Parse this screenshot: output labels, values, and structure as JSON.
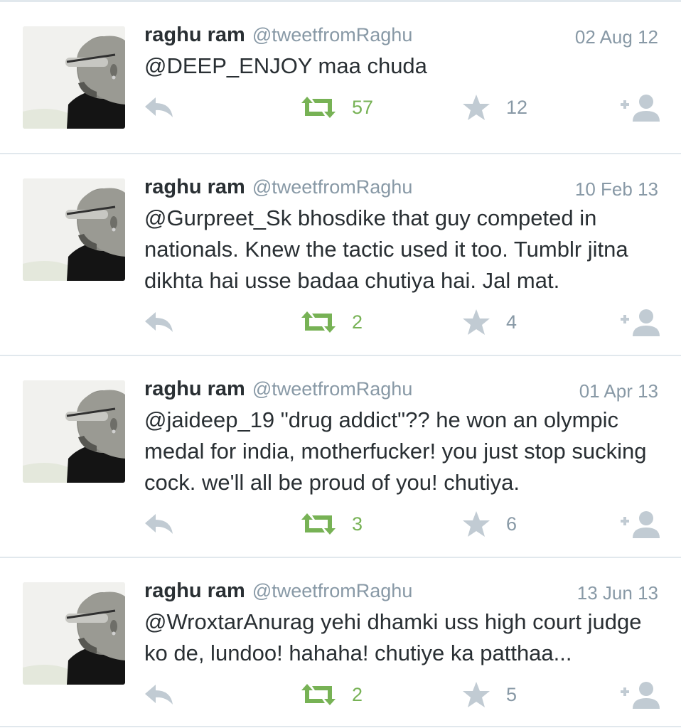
{
  "colors": {
    "retweet_active": "#77b255",
    "icon_gray": "#c1cbd3",
    "meta_gray": "#8899a6",
    "text": "#292f33",
    "divider": "#e1e8ed"
  },
  "icons": {
    "reply": "reply-arrow-icon",
    "retweet": "retweet-icon",
    "favorite": "star-icon",
    "follow": "add-user-icon"
  },
  "tweets": [
    {
      "name": "raghu ram",
      "handle": "@tweetfromRaghu",
      "date": "02 Aug 12",
      "text": "@DEEP_ENJOY maa chuda",
      "retweets": "57",
      "favorites": "12"
    },
    {
      "name": "raghu ram",
      "handle": "@tweetfromRaghu",
      "date": "10 Feb 13",
      "text": "@Gurpreet_Sk bhosdike that guy competed in nationals. Knew the tactic used it too. Tumblr jitna dikhta hai usse badaa chutiya hai. Jal mat.",
      "retweets": "2",
      "favorites": "4"
    },
    {
      "name": "raghu ram",
      "handle": "@tweetfromRaghu",
      "date": "01 Apr 13",
      "text": "@jaideep_19 \"drug addict\"?? he won an olympic medal for india, motherfucker! you just stop sucking cock. we'll all be proud of you! chutiya.",
      "retweets": "3",
      "favorites": "6"
    },
    {
      "name": "raghu ram",
      "handle": "@tweetfromRaghu",
      "date": "13 Jun 13",
      "text": "@WroxtarAnurag yehi dhamki uss high court judge ko de, lundoo! hahaha! chutiye ka patthaa...",
      "retweets": "2",
      "favorites": "5"
    }
  ]
}
